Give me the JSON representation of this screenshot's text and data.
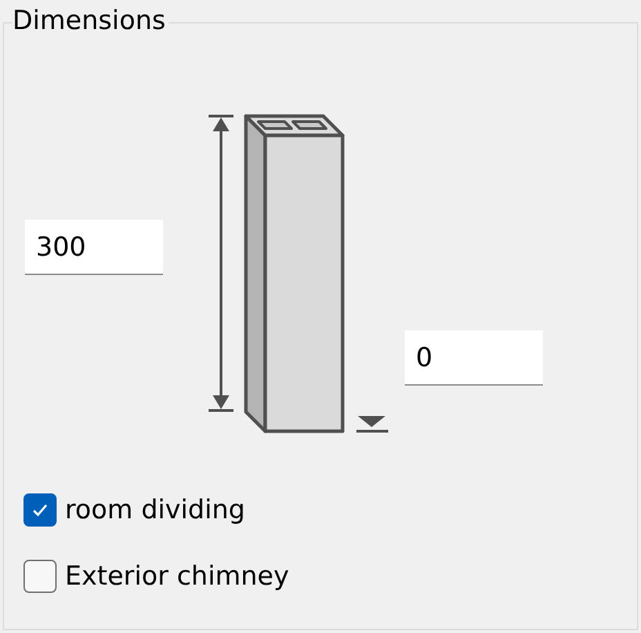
{
  "group": {
    "title": "Dimensions"
  },
  "height_field": {
    "value": "300"
  },
  "offset_field": {
    "value": "0"
  },
  "options": [
    {
      "label": "room dividing",
      "checked": true
    },
    {
      "label": "Exterior chimney",
      "checked": false
    }
  ]
}
